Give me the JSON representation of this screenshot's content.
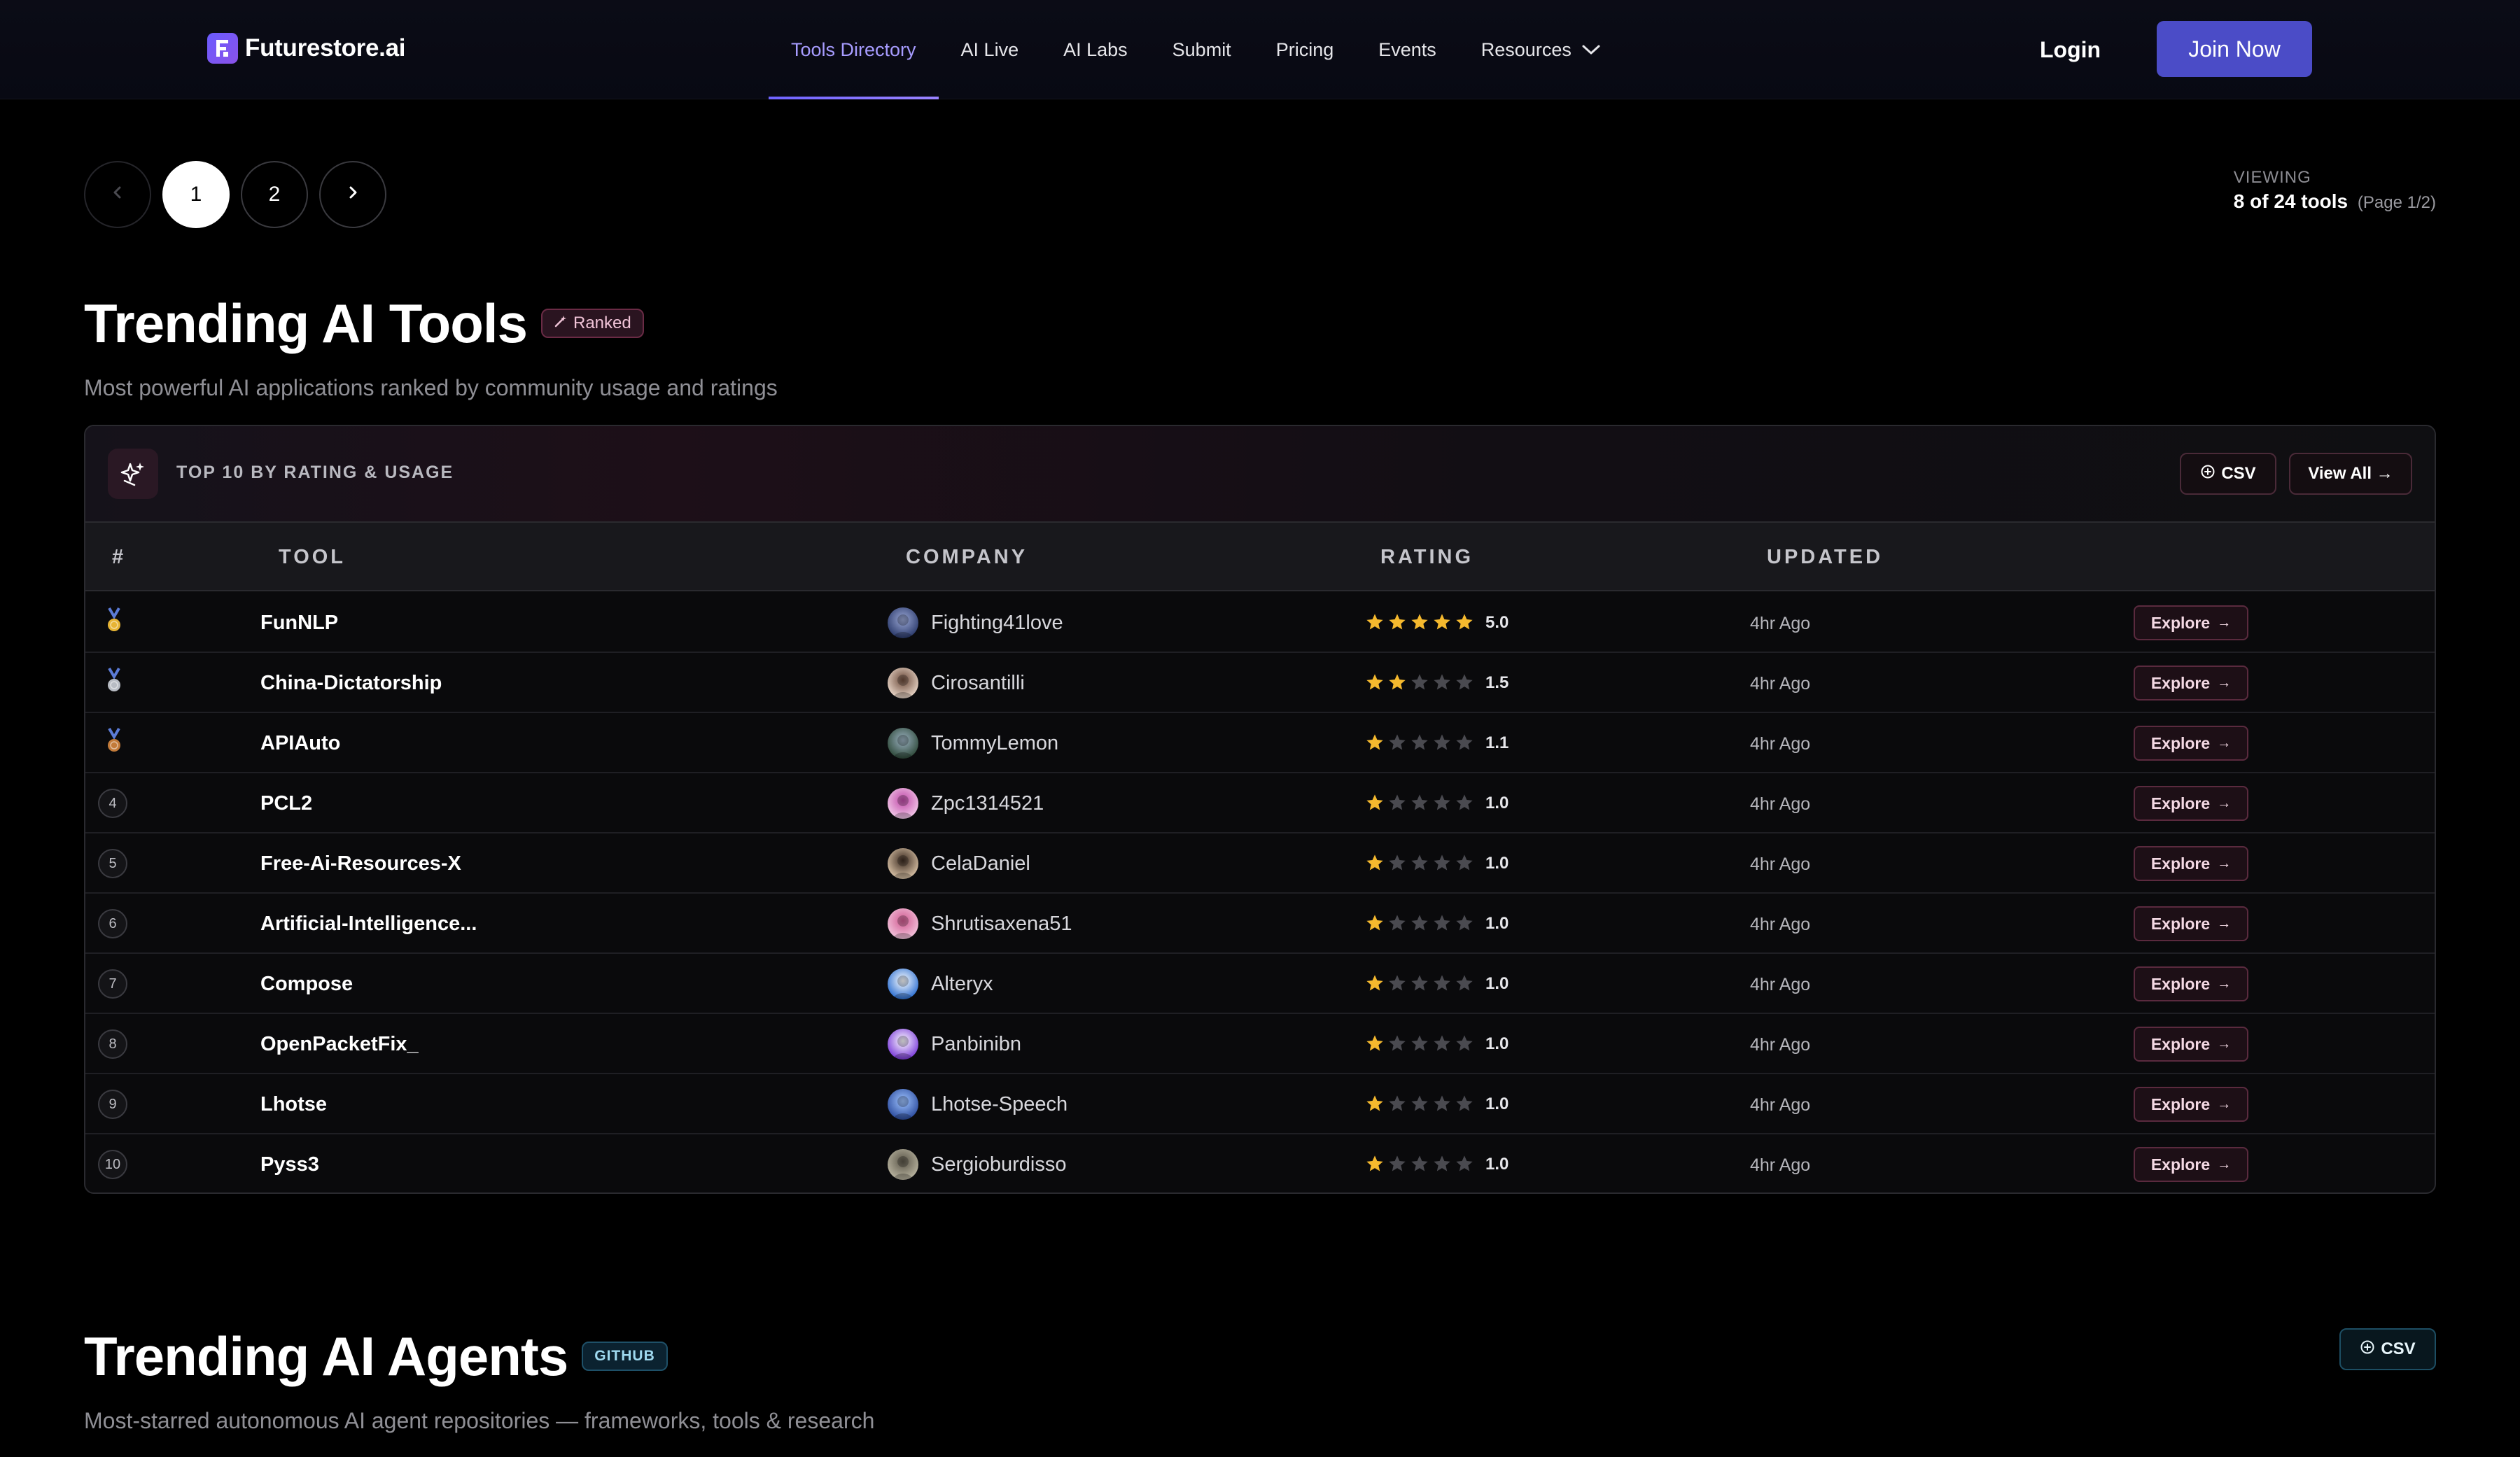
{
  "header": {
    "logo": "Futurestore.ai",
    "nav": [
      "Tools Directory",
      "AI Live",
      "AI Labs",
      "Submit",
      "Pricing",
      "Events",
      "Resources"
    ],
    "login": "Login",
    "join": "Join Now"
  },
  "pagination": {
    "pages": [
      "1",
      "2"
    ],
    "viewing_label": "VIEWING",
    "viewing_value": "8 of 24 tools",
    "viewing_page": "(Page 1/2)"
  },
  "tools_section": {
    "title": "Trending AI Tools",
    "badge": "Ranked",
    "subtitle": "Most powerful AI applications ranked by community usage and ratings",
    "card_title": "TOP 10 BY RATING & USAGE",
    "csv": "CSV",
    "view_all": "View All →",
    "columns": {
      "rank": "#",
      "tool": "TOOL",
      "company": "COMPANY",
      "rating": "RATING",
      "updated": "UPDATED"
    },
    "explore_label": "Explore",
    "rows": [
      {
        "rank": "1",
        "tool": "FunNLP",
        "company": "Fighting41love",
        "rating": "5.0",
        "stars": 5,
        "updated": "4hr Ago"
      },
      {
        "rank": "2",
        "tool": "China-Dictatorship",
        "company": "Cirosantilli",
        "rating": "1.5",
        "stars": 2,
        "updated": "4hr Ago"
      },
      {
        "rank": "3",
        "tool": "APIAuto",
        "company": "TommyLemon",
        "rating": "1.1",
        "stars": 1,
        "updated": "4hr Ago"
      },
      {
        "rank": "4",
        "tool": "PCL2",
        "company": "Zpc1314521",
        "rating": "1.0",
        "stars": 1,
        "updated": "4hr Ago"
      },
      {
        "rank": "5",
        "tool": "Free-Ai-Resources-X",
        "company": "CelaDaniel",
        "rating": "1.0",
        "stars": 1,
        "updated": "4hr Ago"
      },
      {
        "rank": "6",
        "tool": "Artificial-Intelligence...",
        "company": "Shrutisaxena51",
        "rating": "1.0",
        "stars": 1,
        "updated": "4hr Ago"
      },
      {
        "rank": "7",
        "tool": "Compose",
        "company": "Alteryx",
        "rating": "1.0",
        "stars": 1,
        "updated": "4hr Ago"
      },
      {
        "rank": "8",
        "tool": "OpenPacketFix_",
        "company": "Panbinibn",
        "rating": "1.0",
        "stars": 1,
        "updated": "4hr Ago"
      },
      {
        "rank": "9",
        "tool": "Lhotse",
        "company": "Lhotse-Speech",
        "rating": "1.0",
        "stars": 1,
        "updated": "4hr Ago"
      },
      {
        "rank": "10",
        "tool": "Pyss3",
        "company": "Sergioburdisso",
        "rating": "1.0",
        "stars": 1,
        "updated": "4hr Ago"
      }
    ]
  },
  "agents_section": {
    "title": "Trending AI Agents",
    "badge": "GITHUB",
    "subtitle": "Most-starred autonomous AI agent repositories — frameworks, tools & research",
    "csv": "CSV"
  },
  "colors": {
    "accent": "#a79cff",
    "join_button": "#4b4cc7",
    "star_on": "#f5b92e",
    "star_off": "#4a4a50",
    "gold": "#e7b434",
    "silver": "#b8bcc4",
    "bronze": "#c37b3a"
  },
  "icons": {
    "nav_chevron": "chevron-down-icon",
    "prev": "chevron-left-icon",
    "next": "chevron-right-icon",
    "ranked": "magic-wand-icon",
    "card": "sparkles-icon",
    "csv": "plus-circle-icon",
    "medal": "medal-icon",
    "star": "star-icon"
  }
}
